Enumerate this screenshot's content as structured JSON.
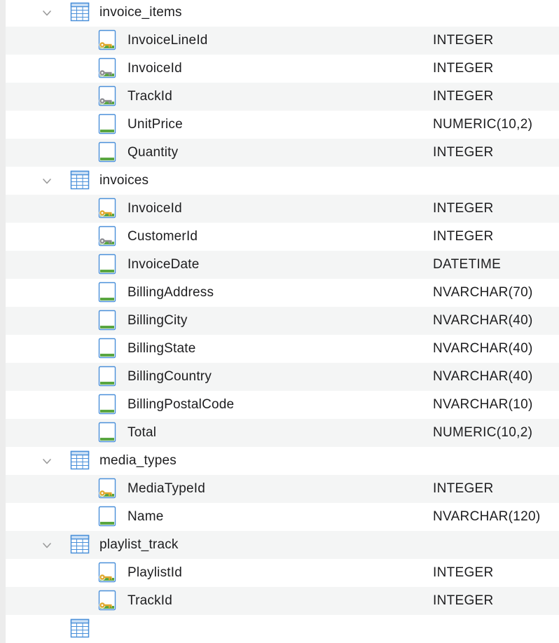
{
  "tables": [
    {
      "name": "invoice_items",
      "expanded": true,
      "columns": [
        {
          "name": "InvoiceLineId",
          "type": "INTEGER",
          "icon": "primary-key-column-icon"
        },
        {
          "name": "InvoiceId",
          "type": "INTEGER",
          "icon": "foreign-key-column-icon"
        },
        {
          "name": "TrackId",
          "type": "INTEGER",
          "icon": "foreign-key-column-icon"
        },
        {
          "name": "UnitPrice",
          "type": "NUMERIC(10,2)",
          "icon": "column-icon"
        },
        {
          "name": "Quantity",
          "type": "INTEGER",
          "icon": "column-icon"
        }
      ]
    },
    {
      "name": "invoices",
      "expanded": true,
      "columns": [
        {
          "name": "InvoiceId",
          "type": "INTEGER",
          "icon": "primary-key-column-icon"
        },
        {
          "name": "CustomerId",
          "type": "INTEGER",
          "icon": "foreign-key-column-icon"
        },
        {
          "name": "InvoiceDate",
          "type": "DATETIME",
          "icon": "column-icon"
        },
        {
          "name": "BillingAddress",
          "type": "NVARCHAR(70)",
          "icon": "column-icon"
        },
        {
          "name": "BillingCity",
          "type": "NVARCHAR(40)",
          "icon": "column-icon"
        },
        {
          "name": "BillingState",
          "type": "NVARCHAR(40)",
          "icon": "column-icon"
        },
        {
          "name": "BillingCountry",
          "type": "NVARCHAR(40)",
          "icon": "column-icon"
        },
        {
          "name": "BillingPostalCode",
          "type": "NVARCHAR(10)",
          "icon": "column-icon"
        },
        {
          "name": "Total",
          "type": "NUMERIC(10,2)",
          "icon": "column-icon"
        }
      ]
    },
    {
      "name": "media_types",
      "expanded": true,
      "columns": [
        {
          "name": "MediaTypeId",
          "type": "INTEGER",
          "icon": "primary-key-column-icon"
        },
        {
          "name": "Name",
          "type": "NVARCHAR(120)",
          "icon": "column-icon"
        }
      ]
    },
    {
      "name": "playlist_track",
      "expanded": true,
      "columns": [
        {
          "name": "PlaylistId",
          "type": "INTEGER",
          "icon": "primary-key-column-icon"
        },
        {
          "name": "TrackId",
          "type": "INTEGER",
          "icon": "primary-key-column-icon"
        }
      ]
    }
  ],
  "colors": {
    "row_alt": "#f4f5f5",
    "table_icon_blue": "#4a90d9",
    "column_bar_green": "#5aa641",
    "primary_key_gold": "#e0a82e",
    "foreign_key_gray": "#8e8e93",
    "chevron_gray": "#9a9a9a"
  }
}
